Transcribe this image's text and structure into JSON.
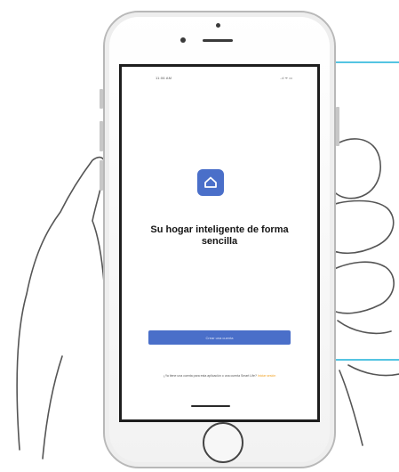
{
  "status_bar": {
    "time": "11:06 AM",
    "icons": "..ıl ᯤ ▭"
  },
  "app": {
    "icon_name": "home-outline-icon",
    "accent_color": "#4a6fc9",
    "headline": "Su hogar inteligente de forma sencilla",
    "create_button_label": "Crear una cuenta",
    "footer_text": "¿Ya tiene una cuenta para esta aplicación o una cuenta Smart Life?",
    "footer_link": "Iniciar sesión",
    "link_color": "#f0a020"
  }
}
